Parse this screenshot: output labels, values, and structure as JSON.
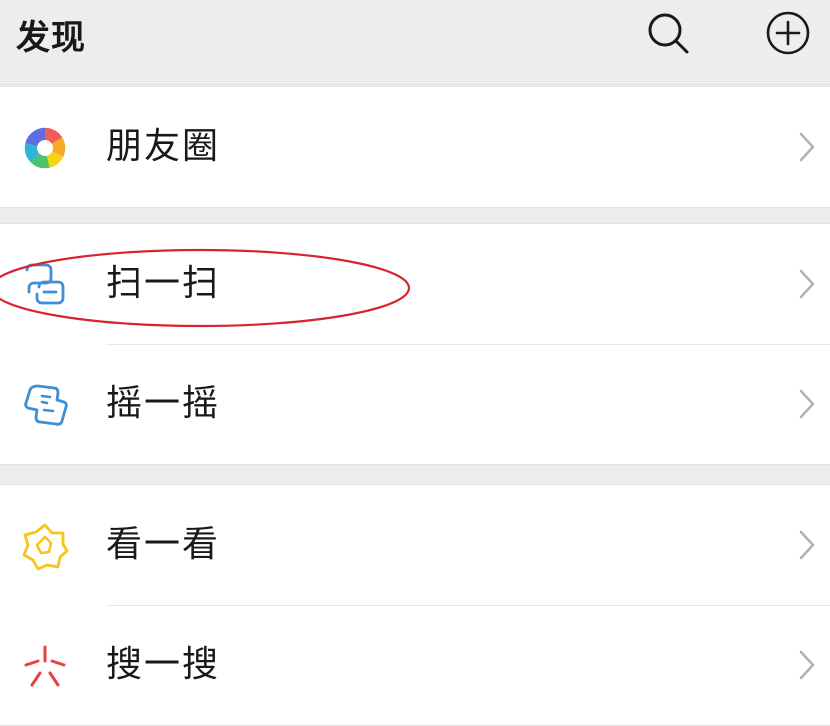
{
  "header": {
    "title": "发现",
    "search_icon": "search-icon",
    "add_icon": "plus-circle-icon"
  },
  "menu": {
    "groups": [
      {
        "items": [
          {
            "label": "朋友圈",
            "icon": "moments-icon"
          }
        ]
      },
      {
        "items": [
          {
            "label": "扫一扫",
            "icon": "scan-icon"
          },
          {
            "label": "摇一摇",
            "icon": "shake-icon"
          }
        ]
      },
      {
        "items": [
          {
            "label": "看一看",
            "icon": "top-stories-icon"
          },
          {
            "label": "搜一搜",
            "icon": "search-search-icon"
          }
        ]
      }
    ]
  },
  "colors": {
    "background": "#ededed",
    "item_background": "#ffffff",
    "text": "#191919",
    "chevron": "#b2b2b2",
    "annotation": "#d9232d",
    "scan_icon": "#3d8fd6",
    "shake_icon": "#3d8fd6",
    "top_stories_icon": "#f5c518",
    "search_icon": "#e64340"
  }
}
